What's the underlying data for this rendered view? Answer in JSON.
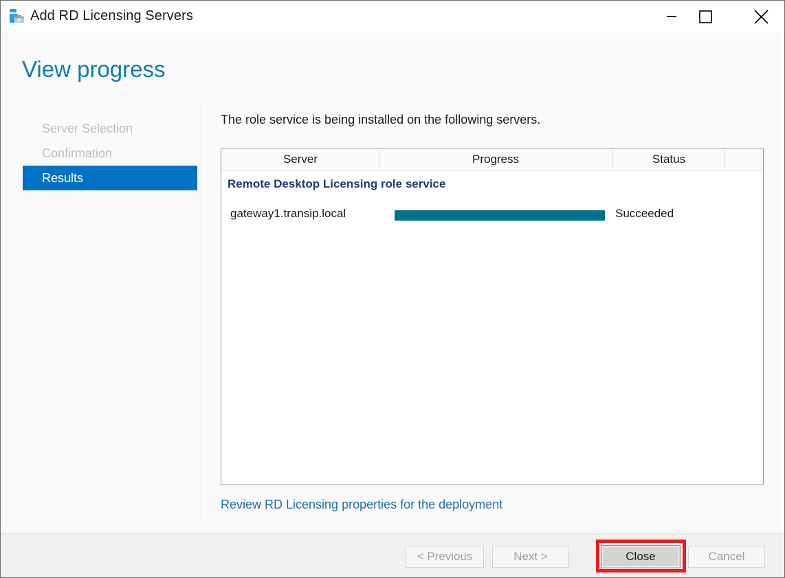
{
  "window": {
    "title": "Add RD Licensing Servers",
    "icon": "rd-licensing-servers-icon",
    "controls": {
      "minimize": "minimize-icon",
      "maximize": "maximize-icon",
      "close": "close-icon"
    }
  },
  "page": {
    "heading": "View progress",
    "heading_color": "#1278b4"
  },
  "nav": {
    "items": [
      {
        "label": "Server Selection",
        "selected": false
      },
      {
        "label": "Confirmation",
        "selected": false
      },
      {
        "label": "Results",
        "selected": true
      }
    ],
    "selected_color": "#0072c6"
  },
  "main": {
    "instruction": "The role service is being installed on the following servers.",
    "table": {
      "columns": [
        "Server",
        "Progress",
        "Status",
        ""
      ],
      "groups": [
        {
          "label": "Remote Desktop Licensing role service",
          "rows": [
            {
              "server": "gateway1.transip.local",
              "progress_percent": 100,
              "progress_color": "#00708f",
              "status": "Succeeded"
            }
          ]
        }
      ]
    },
    "link": "Review RD Licensing properties for the deployment"
  },
  "footer": {
    "buttons": [
      {
        "label": "< Previous",
        "enabled": false
      },
      {
        "label": "Next >",
        "enabled": false
      },
      {
        "label": "Close",
        "enabled": true,
        "highlighted": true
      },
      {
        "label": "Cancel",
        "enabled": false
      }
    ],
    "highlight_color": "#ee1b1b"
  }
}
